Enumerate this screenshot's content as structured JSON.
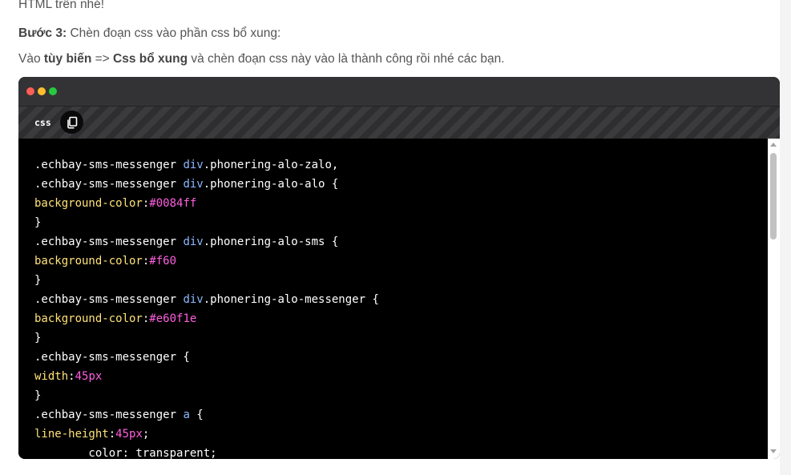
{
  "intro": {
    "line1": "HTML trên nhé!",
    "step_label": "Bước 3:",
    "step_text": " Chèn đoạn css vào phần css bổ xung:",
    "instr_prefix": "Vào ",
    "instr_bold1": "tùy biến",
    "instr_arrow": " => ",
    "instr_bold2": "Css bổ xung",
    "instr_suffix": " và chèn đoạn css này vào là thành công rồi nhé các bạn."
  },
  "code_block": {
    "language": "css",
    "window_dots": [
      "#ff5f56",
      "#ffbd2e",
      "#27c93f"
    ],
    "copy_icon": "copy-icon",
    "lines": [
      [
        [
          ".echbay-sms-messenger ",
          "plain"
        ],
        [
          "div",
          "tag"
        ],
        [
          ".phonering-alo-zalo,",
          "plain"
        ]
      ],
      [
        [
          ".echbay-sms-messenger ",
          "plain"
        ],
        [
          "div",
          "tag"
        ],
        [
          ".phonering-alo-alo {",
          "plain"
        ]
      ],
      [
        [
          "background-color",
          "prop"
        ],
        [
          ":",
          "plain"
        ],
        [
          "#0084ff",
          "val"
        ]
      ],
      [
        [
          "}",
          "plain"
        ]
      ],
      [
        [
          ".echbay-sms-messenger ",
          "plain"
        ],
        [
          "div",
          "tag"
        ],
        [
          ".phonering-alo-sms {",
          "plain"
        ]
      ],
      [
        [
          "background-color",
          "prop"
        ],
        [
          ":",
          "plain"
        ],
        [
          "#f60",
          "val"
        ]
      ],
      [
        [
          "}",
          "plain"
        ]
      ],
      [
        [
          ".echbay-sms-messenger ",
          "plain"
        ],
        [
          "div",
          "tag"
        ],
        [
          ".phonering-alo-messenger {",
          "plain"
        ]
      ],
      [
        [
          "background-color",
          "prop"
        ],
        [
          ":",
          "plain"
        ],
        [
          "#e60f1e",
          "val"
        ]
      ],
      [
        [
          "}",
          "plain"
        ]
      ],
      [
        [
          ".echbay-sms-messenger {",
          "plain"
        ]
      ],
      [
        [
          "width",
          "prop"
        ],
        [
          ":",
          "plain"
        ],
        [
          "45px",
          "val"
        ]
      ],
      [
        [
          "}",
          "plain"
        ]
      ],
      [
        [
          ".echbay-sms-messenger ",
          "plain"
        ],
        [
          "a",
          "tag"
        ],
        [
          " {",
          "plain"
        ]
      ],
      [
        [
          "line-height",
          "prop"
        ],
        [
          ":",
          "plain"
        ],
        [
          "45px",
          "val"
        ],
        [
          ";",
          "plain"
        ]
      ],
      [
        [
          "        color: transparent;",
          "plain"
        ]
      ]
    ]
  },
  "colors": {
    "selector": "#ffffff",
    "tag": "#8eb8ff",
    "property": "#ffe278",
    "value": "#ff5fe0",
    "code_bg": "#000000",
    "titlebar_bg": "#333335"
  }
}
